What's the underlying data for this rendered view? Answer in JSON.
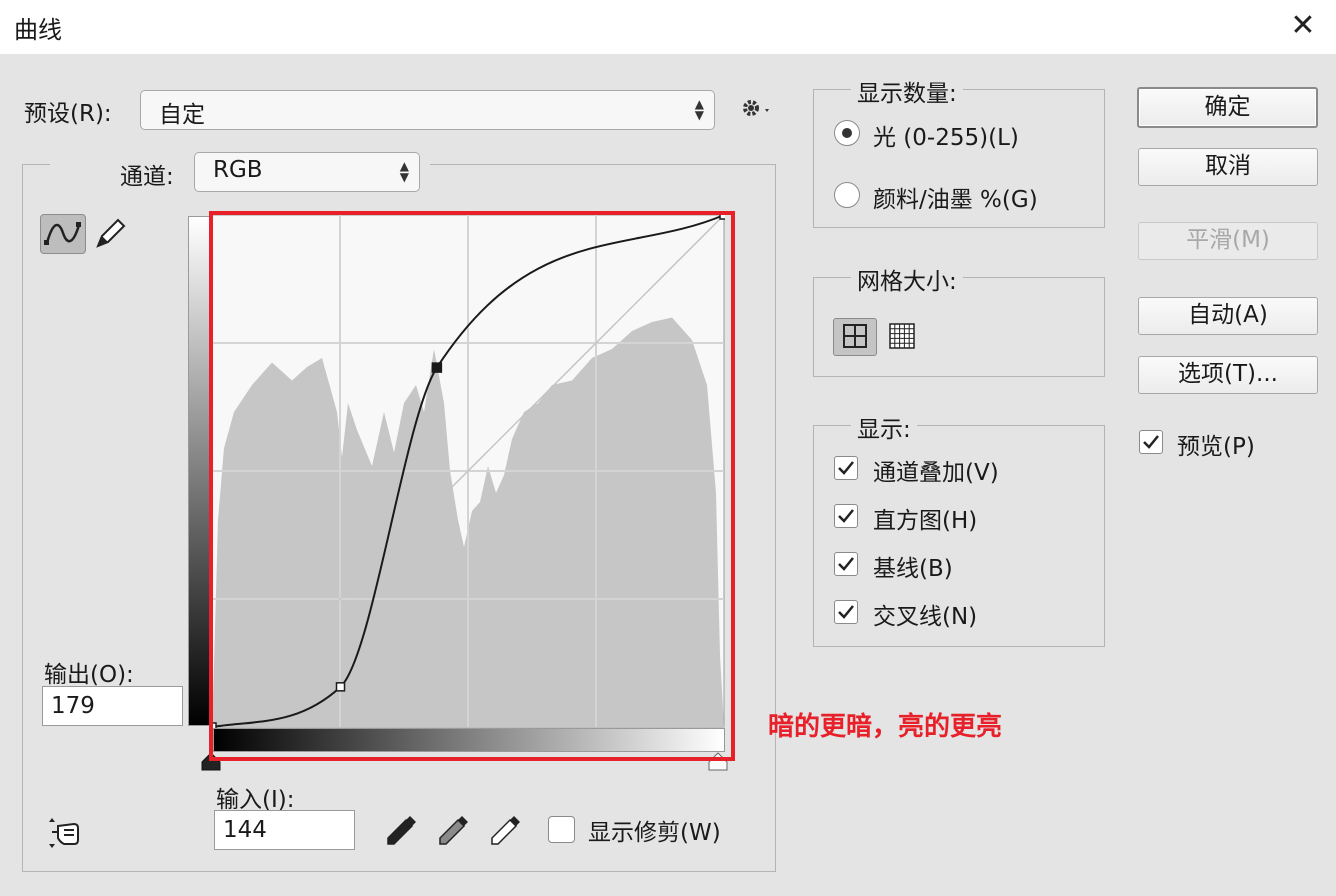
{
  "window": {
    "title": "曲线",
    "close_icon": "close-icon"
  },
  "preset": {
    "label": "预设(R):",
    "value": "自定",
    "gear_icon": "gear-icon"
  },
  "channel": {
    "label": "通道:",
    "value": "RGB"
  },
  "tools": {
    "curve_tool_icon": "curve-point-icon",
    "pencil_tool_icon": "pencil-icon",
    "hand_icon": "on-image-adjust-icon"
  },
  "output": {
    "label": "输出(O):",
    "value": "179"
  },
  "input": {
    "label": "输入(I):",
    "value": "144"
  },
  "eyedroppers": [
    "black-eyedropper-icon",
    "gray-eyedropper-icon",
    "white-eyedropper-icon"
  ],
  "show_clipping": {
    "label": "显示修剪(W)",
    "checked": false
  },
  "curve": {
    "points": [
      [
        0,
        0
      ],
      [
        64,
        20
      ],
      [
        112,
        179
      ],
      [
        255,
        255
      ]
    ],
    "selected_point": [
      112,
      179
    ],
    "histogram_color": "#c6c6c6"
  },
  "amount_group": {
    "title": "显示数量:",
    "options": [
      {
        "label": "光 (0-255)(L)",
        "selected": true
      },
      {
        "label": "颜料/油墨 %(G)",
        "selected": false
      }
    ]
  },
  "grid_group": {
    "title": "网格大小:",
    "simple_icon": "grid-4x4-icon",
    "detailed_icon": "grid-10x10-icon"
  },
  "display_group": {
    "title": "显示:",
    "items": [
      {
        "label": "通道叠加(V)",
        "checked": true
      },
      {
        "label": "直方图(H)",
        "checked": true
      },
      {
        "label": "基线(B)",
        "checked": true
      },
      {
        "label": "交叉线(N)",
        "checked": true
      }
    ]
  },
  "buttons": {
    "ok": "确定",
    "cancel": "取消",
    "smooth": "平滑(M)",
    "auto": "自动(A)",
    "options": "选项(T)..."
  },
  "preview": {
    "label": "预览(P)",
    "checked": true
  },
  "annotation": {
    "text": "暗的更暗，亮的更亮",
    "color": "#e8202a"
  }
}
